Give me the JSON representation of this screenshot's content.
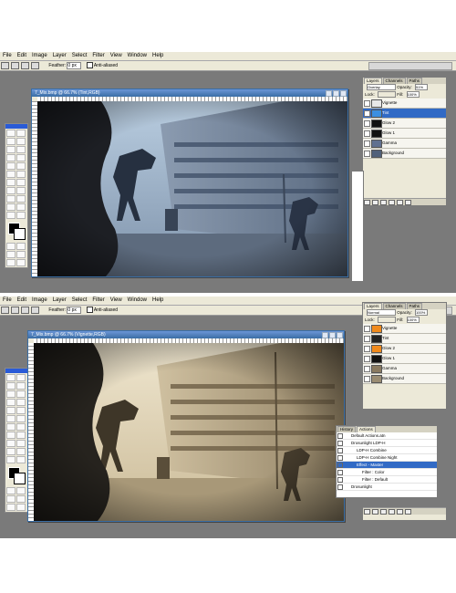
{
  "menu": [
    "File",
    "Edit",
    "Image",
    "Layer",
    "Select",
    "Filter",
    "View",
    "Window",
    "Help"
  ],
  "options": {
    "feather_label": "Feather:",
    "feather_value": "0 px",
    "antialias_label": "Anti-aliased"
  },
  "top": {
    "doc_title": "7_Mix.bmp @ 66.7% (Tint,RGB)",
    "layers_tabs": [
      "Layers",
      "Channels",
      "Paths"
    ],
    "blend_mode": "Overlay",
    "opacity_label": "Opacity:",
    "opacity_value": "51%",
    "lock_label": "Lock:",
    "fill_label": "Fill:",
    "fill_value": "100%",
    "layers": [
      {
        "name": "Vignette",
        "selected": false,
        "color": "#e8e8e8"
      },
      {
        "name": "Tint",
        "selected": true,
        "color": "#3c8fe0"
      },
      {
        "name": "Glow 2",
        "selected": false,
        "color": "#111111"
      },
      {
        "name": "Glow 1",
        "selected": false,
        "color": "#111111"
      },
      {
        "name": "Gamma",
        "selected": false,
        "color": "#607090"
      },
      {
        "name": "Background",
        "selected": false,
        "color": "#50607a"
      }
    ]
  },
  "bottom": {
    "doc_title": "7_Mix.bmp @ 66.7% (Vignette,RGB)",
    "layers_tabs": [
      "Layers",
      "Channels",
      "Paths"
    ],
    "blend_mode": "Normal",
    "opacity_label": "Opacity:",
    "opacity_value": "100%",
    "lock_label": "Lock:",
    "fill_label": "Fill:",
    "fill_value": "100%",
    "layers": [
      {
        "name": "Vignette",
        "selected": false,
        "color": "#f08a1c"
      },
      {
        "name": "Tint",
        "selected": false,
        "color": "#222222"
      },
      {
        "name": "Glow 2",
        "selected": false,
        "color": "#f08a1c"
      },
      {
        "name": "Glow 1",
        "selected": false,
        "color": "#111111"
      },
      {
        "name": "Gamma",
        "selected": false,
        "color": "#8a7a60"
      },
      {
        "name": "Background",
        "selected": false,
        "color": "#9a8c72"
      }
    ],
    "actions_tabs": [
      "History",
      "Actions"
    ],
    "actions": [
      {
        "label": "Default Actions.atn",
        "level": 0,
        "selected": false
      },
      {
        "label": "Drosunlight LDP-H",
        "level": 0,
        "selected": false
      },
      {
        "label": "LDP-H Combine",
        "level": 1,
        "selected": false
      },
      {
        "label": "LDP-H Combine Night",
        "level": 1,
        "selected": false
      },
      {
        "label": "Effect - Master",
        "level": 1,
        "selected": true
      },
      {
        "label": "Filter : Color",
        "level": 2,
        "selected": false
      },
      {
        "label": "Filter : Default",
        "level": 2,
        "selected": false
      },
      {
        "label": "Drosunlight",
        "level": 0,
        "selected": false
      }
    ]
  }
}
